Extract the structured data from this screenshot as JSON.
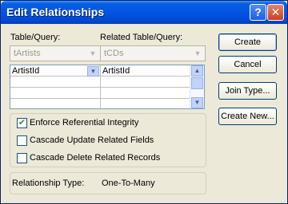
{
  "window": {
    "title": "Edit Relationships",
    "help_glyph": "?",
    "close_glyph": "✕"
  },
  "labels": {
    "table_query": "Table/Query:",
    "related_table_query": "Related Table/Query:"
  },
  "combos": {
    "table": "tArtists",
    "related": "tCDs"
  },
  "grid": {
    "rows": [
      {
        "left": "ArtistId",
        "right": "ArtistId"
      }
    ]
  },
  "buttons": {
    "create": "Create",
    "cancel": "Cancel",
    "join_type": "Join Type...",
    "create_new": "Create New..."
  },
  "options": {
    "enforce": {
      "label": "Enforce Referential Integrity",
      "checked": true
    },
    "cascade_update": {
      "label": "Cascade Update Related Fields",
      "checked": false
    },
    "cascade_delete": {
      "label": "Cascade Delete Related Records",
      "checked": false
    }
  },
  "relationship": {
    "label": "Relationship Type:",
    "value": "One-To-Many"
  }
}
